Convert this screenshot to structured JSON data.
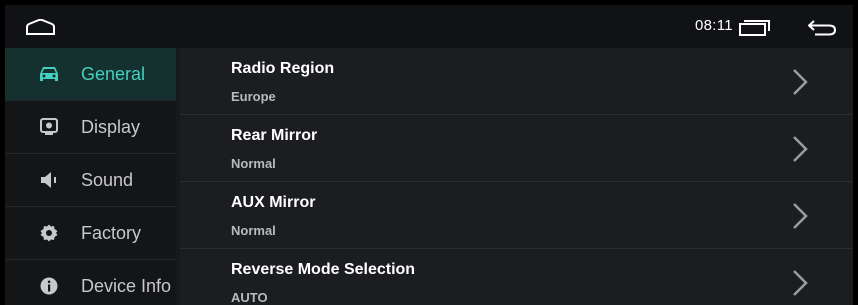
{
  "statusbar": {
    "time": "08:11",
    "icons": [
      "home-icon",
      "recent-apps-icon",
      "back-arrow-icon"
    ]
  },
  "sidebar": {
    "items": [
      {
        "label": "General",
        "icon": "car-icon",
        "active": true
      },
      {
        "label": "Display",
        "icon": "display-icon",
        "active": false
      },
      {
        "label": "Sound",
        "icon": "speaker-icon",
        "active": false
      },
      {
        "label": "Factory",
        "icon": "gear-icon",
        "active": false
      },
      {
        "label": "Device Info",
        "icon": "info-icon",
        "active": false
      }
    ]
  },
  "settings": {
    "rows": [
      {
        "title": "Radio Region",
        "value": "Europe"
      },
      {
        "title": "Rear Mirror",
        "value": "Normal"
      },
      {
        "title": "AUX Mirror",
        "value": "Normal"
      },
      {
        "title": "Reverse Mode Selection",
        "value": "AUTO"
      }
    ]
  },
  "colors": {
    "accent": "#45cfc0",
    "background": "#1c1d21",
    "sidebar": "#141517",
    "active_item": "#15312f"
  }
}
